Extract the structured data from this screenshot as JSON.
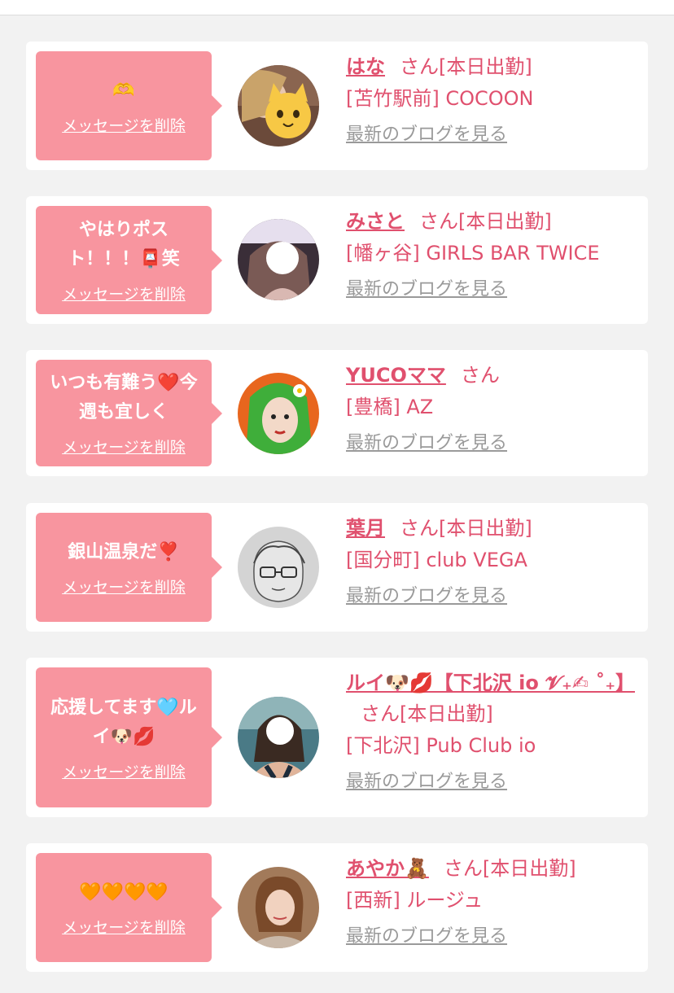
{
  "colors": {
    "accent": "#e0506e",
    "bubble": "#f8959f",
    "muted": "#9a9a9a",
    "background": "#f2f2f2"
  },
  "delete_label": "メッセージを削除",
  "blog_label": "最新のブログを見る",
  "cards": [
    {
      "message": "🫶",
      "name": "はな",
      "suffix": "さん[本日出勤]",
      "shop": "[苫竹駅前] COCOON",
      "avatar_icon": "cat-emoji-photo"
    },
    {
      "message": "やはりポスト！！！📮笑",
      "name": "みさと",
      "suffix": "さん[本日出勤]",
      "shop": "[幡ヶ谷] GIRLS BAR TWICE",
      "avatar_icon": "blurred-face-photo"
    },
    {
      "message": "いつも有難う❤️今週も宜しく",
      "name": "YUCOママ",
      "suffix": "さん",
      "shop": "[豊橋] AZ",
      "avatar_icon": "green-hair-illustration"
    },
    {
      "message": "銀山温泉だ❣️",
      "name": "葉月",
      "suffix": "さん[本日出勤]",
      "shop": "[国分町] club VEGA",
      "avatar_icon": "glasses-sketch"
    },
    {
      "message": "応援してます🩵ルイ🐶💋",
      "name": "ルイ🐶💋【下北沢 io 𝓥₊✍︎ ˚₊】",
      "suffix": "さん[本日出勤]",
      "shop": "[下北沢] Pub Club io",
      "avatar_icon": "selfie-photo"
    },
    {
      "message": "🧡🧡🧡🧡",
      "name": "あやか🧸",
      "suffix": "さん[本日出勤]",
      "shop": "[西新] ルージュ",
      "avatar_icon": "portrait-photo"
    }
  ]
}
